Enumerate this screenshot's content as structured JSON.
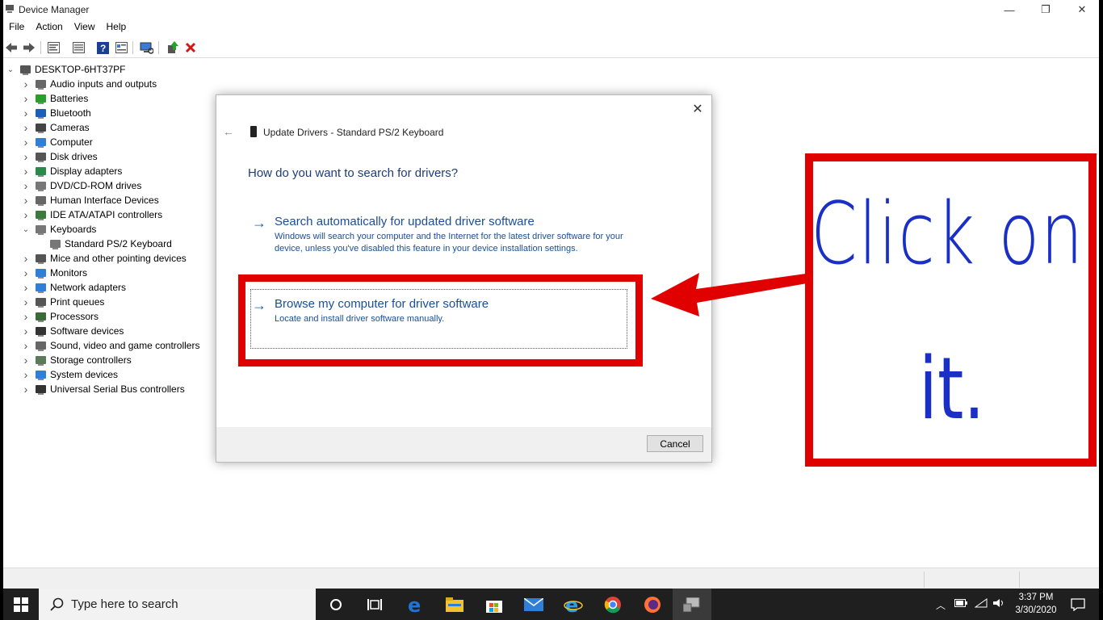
{
  "window": {
    "title": "Device Manager",
    "minimize": "—",
    "maximize": "❐",
    "close": "✕"
  },
  "menu": [
    "File",
    "Action",
    "View",
    "Help"
  ],
  "tree": {
    "root": "DESKTOP-6HT37PF",
    "items": [
      {
        "label": "Audio inputs and outputs",
        "icon": "speaker-icon"
      },
      {
        "label": "Batteries",
        "icon": "battery-icon"
      },
      {
        "label": "Bluetooth",
        "icon": "bluetooth-icon"
      },
      {
        "label": "Cameras",
        "icon": "camera-icon"
      },
      {
        "label": "Computer",
        "icon": "monitor-icon"
      },
      {
        "label": "Disk drives",
        "icon": "disk-icon"
      },
      {
        "label": "Display adapters",
        "icon": "display-adapter-icon"
      },
      {
        "label": "DVD/CD-ROM drives",
        "icon": "dvd-icon"
      },
      {
        "label": "Human Interface Devices",
        "icon": "hid-icon"
      },
      {
        "label": "IDE ATA/ATAPI controllers",
        "icon": "ide-icon"
      },
      {
        "label": "Keyboards",
        "icon": "keyboard-icon",
        "expanded": true
      },
      {
        "label": "Standard PS/2 Keyboard",
        "icon": "keyboard-icon",
        "child": true
      },
      {
        "label": "Mice and other pointing devices",
        "icon": "mouse-icon"
      },
      {
        "label": "Monitors",
        "icon": "monitor-icon"
      },
      {
        "label": "Network adapters",
        "icon": "network-icon"
      },
      {
        "label": "Print queues",
        "icon": "printer-icon"
      },
      {
        "label": "Processors",
        "icon": "processor-icon"
      },
      {
        "label": "Software devices",
        "icon": "software-device-icon"
      },
      {
        "label": "Sound, video and game controllers",
        "icon": "speaker-icon"
      },
      {
        "label": "Storage controllers",
        "icon": "storage-icon"
      },
      {
        "label": "System devices",
        "icon": "system-icon"
      },
      {
        "label": "Universal Serial Bus controllers",
        "icon": "usb-icon"
      }
    ]
  },
  "dialog": {
    "header": "Update Drivers - Standard PS/2 Keyboard",
    "question": "How do you want to search for drivers?",
    "option1_title": "Search automatically for updated driver software",
    "option1_desc": "Windows will search your computer and the Internet for the latest driver software for your device, unless you've disabled this feature in your device installation settings.",
    "option2_title": "Browse my computer for driver software",
    "option2_desc": "Locate and install driver software manually.",
    "cancel": "Cancel"
  },
  "annotation": {
    "line1": "Click on",
    "line2": "it.",
    "color": "#1a2fc6",
    "box_color": "#e00000"
  },
  "taskbar": {
    "search_placeholder": "Type here to search",
    "time": "3:37 PM",
    "date": "3/30/2020"
  }
}
